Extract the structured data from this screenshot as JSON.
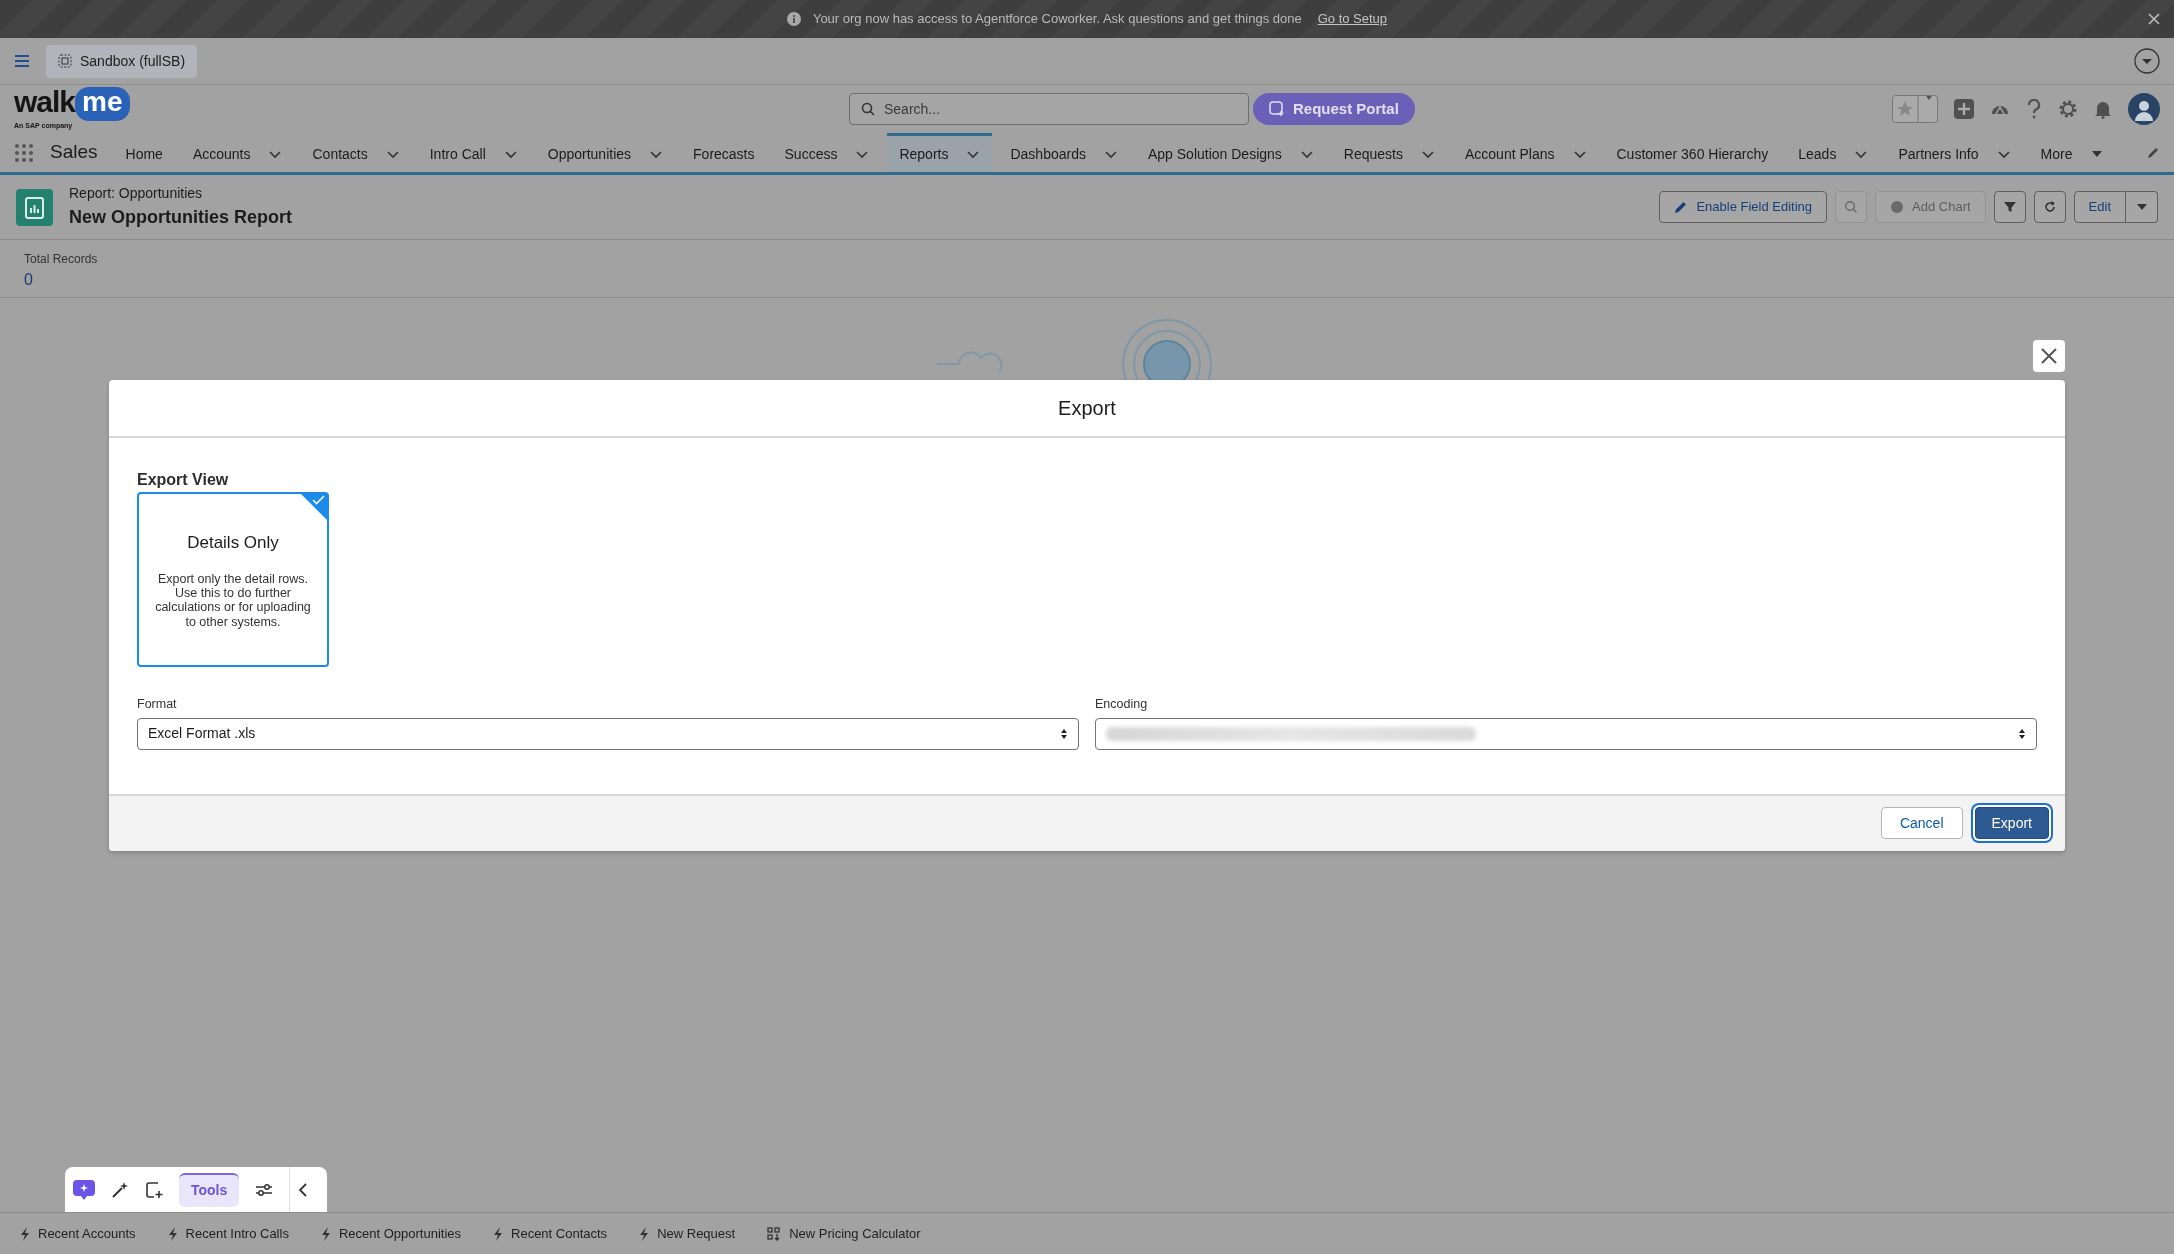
{
  "banner": {
    "message": "Your org now has access to Agentforce Coworker. Ask questions and get things done",
    "link": "Go to Setup"
  },
  "org_switcher": {
    "label": "Sandbox (fullSB)"
  },
  "logo": {
    "word": "walk",
    "bubble": "me",
    "tagline": "An SAP company"
  },
  "search": {
    "placeholder": "Search..."
  },
  "request_portal": {
    "label": "Request Portal"
  },
  "app_name": "Sales",
  "nav": [
    {
      "label": "Home",
      "dropdown": false,
      "selected": false
    },
    {
      "label": "Accounts",
      "dropdown": true,
      "selected": false
    },
    {
      "label": "Contacts",
      "dropdown": true,
      "selected": false
    },
    {
      "label": "Intro Call",
      "dropdown": true,
      "selected": false
    },
    {
      "label": "Opportunities",
      "dropdown": true,
      "selected": false
    },
    {
      "label": "Forecasts",
      "dropdown": false,
      "selected": false
    },
    {
      "label": "Success",
      "dropdown": true,
      "selected": false
    },
    {
      "label": "Reports",
      "dropdown": true,
      "selected": true
    },
    {
      "label": "Dashboards",
      "dropdown": true,
      "selected": false
    },
    {
      "label": "App Solution Designs",
      "dropdown": true,
      "selected": false
    },
    {
      "label": "Requests",
      "dropdown": true,
      "selected": false
    },
    {
      "label": "Account Plans",
      "dropdown": true,
      "selected": false
    },
    {
      "label": "Customer 360 Hierarchy",
      "dropdown": false,
      "selected": false
    },
    {
      "label": "Leads",
      "dropdown": true,
      "selected": false
    },
    {
      "label": "Partners Info",
      "dropdown": true,
      "selected": false
    },
    {
      "label": "More",
      "dropdown": true,
      "selected": false
    }
  ],
  "report": {
    "type": "Report: Opportunities",
    "title": "New Opportunities Report"
  },
  "toolbar": [
    {
      "kind": "field-editing",
      "label": "Enable Field Editing",
      "disabled": false
    },
    {
      "kind": "search",
      "disabled": true
    },
    {
      "kind": "add-chart",
      "label": "Add Chart",
      "disabled": true
    },
    {
      "kind": "filter",
      "disabled": false
    },
    {
      "kind": "refresh",
      "disabled": false
    },
    {
      "kind": "edit",
      "label": "Edit",
      "disabled": false
    },
    {
      "kind": "menu",
      "disabled": false
    }
  ],
  "summary": {
    "label": "Total Records",
    "value": "0"
  },
  "modal": {
    "title": "Export",
    "section": "Export View",
    "views": [
      {
        "title": "Details Only",
        "description": "Export only the detail rows. Use this to do further calculations or for uploading to other systems.",
        "selected": true
      }
    ],
    "format": {
      "label": "Format",
      "value": "Excel Format .xls"
    },
    "encoding": {
      "label": "Encoding"
    },
    "buttons": [
      {
        "kind": "secondary",
        "label": "Cancel"
      },
      {
        "kind": "primary",
        "label": "Export"
      }
    ]
  },
  "assistant_bar": {
    "tabs": [
      {
        "label": "Tools",
        "selected": true
      }
    ]
  },
  "utility_bar": [
    {
      "kind": "lightning",
      "label": "Recent Accounts"
    },
    {
      "kind": "lightning",
      "label": "Recent Intro Calls"
    },
    {
      "kind": "lightning",
      "label": "Recent Opportunities"
    },
    {
      "kind": "lightning",
      "label": "Recent Contacts"
    },
    {
      "kind": "lightning",
      "label": "New Request"
    },
    {
      "kind": "calculator",
      "label": "New Pricing Calculator"
    }
  ]
}
